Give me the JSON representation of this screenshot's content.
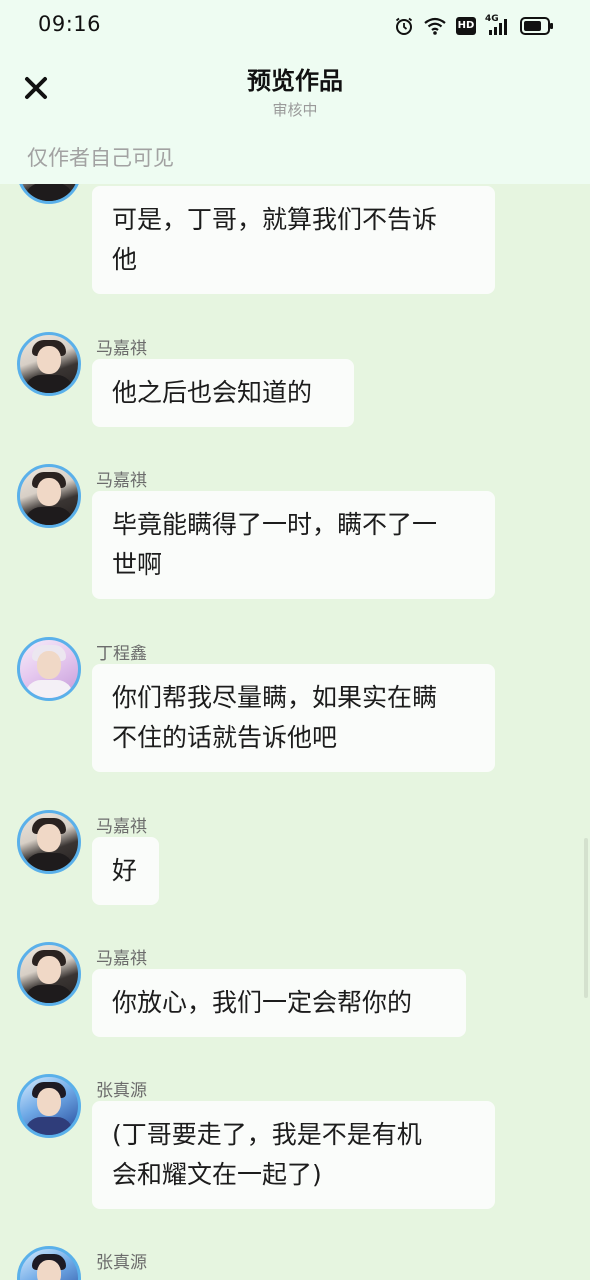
{
  "status": {
    "time": "09:16",
    "icons": [
      "alarm-icon",
      "wifi-icon",
      "hd-icon",
      "4g-signal-icon",
      "battery-icon"
    ],
    "hd_label": "HD",
    "network_label": "4G"
  },
  "header": {
    "close_icon": "close-icon",
    "title": "预览作品",
    "subtitle": "审核中"
  },
  "visibility": "仅作者自己可见",
  "colors": {
    "background": "#e6f5e0",
    "header_background": "#eefcf2",
    "bubble": "#fafcfa",
    "avatar_ring": "#5ab0ea"
  },
  "messages": [
    {
      "sender": "",
      "avatar": "avatar-ma-jiaqi",
      "lines": [
        "可是，丁哥，就算我们不告诉",
        "他"
      ]
    },
    {
      "sender": "马嘉祺",
      "avatar": "avatar-ma-jiaqi",
      "lines": [
        "他之后也会知道的"
      ]
    },
    {
      "sender": "马嘉祺",
      "avatar": "avatar-ma-jiaqi",
      "lines": [
        "毕竟能瞒得了一时，瞒不了一",
        "世啊"
      ]
    },
    {
      "sender": "丁程鑫",
      "avatar": "avatar-ding-chengxin",
      "lines": [
        "你们帮我尽量瞒，如果实在瞒",
        "不住的话就告诉他吧"
      ]
    },
    {
      "sender": "马嘉祺",
      "avatar": "avatar-ma-jiaqi",
      "lines": [
        "好"
      ]
    },
    {
      "sender": "马嘉祺",
      "avatar": "avatar-ma-jiaqi",
      "lines": [
        "你放心，我们一定会帮你的"
      ]
    },
    {
      "sender": "张真源",
      "avatar": "avatar-zhang-zhenyuan",
      "lines": [
        "(丁哥要走了，我是不是有机",
        "会和耀文在一起了)"
      ]
    },
    {
      "sender": "张真源",
      "avatar": "avatar-zhang-zhenyuan",
      "lines": []
    }
  ]
}
